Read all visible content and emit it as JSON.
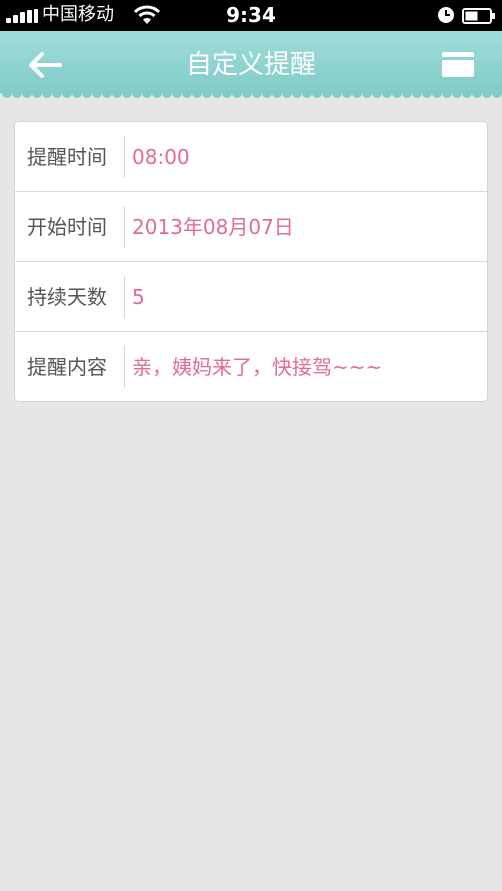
{
  "status_bar": {
    "carrier": "中国移动",
    "time": "9:34"
  },
  "header": {
    "title": "自定义提醒",
    "back_icon": "arrow-left-icon",
    "save_icon": "save-icon",
    "color": "#8fd3d0"
  },
  "form": {
    "rows": [
      {
        "label": "提醒时间",
        "value": "08:00"
      },
      {
        "label": "开始时间",
        "value": "2013年08月07日"
      },
      {
        "label": "持续天数",
        "value": "5"
      },
      {
        "label": "提醒内容",
        "value": "亲，姨妈来了，快接驾~~~"
      }
    ],
    "value_color": "#e56a93"
  }
}
